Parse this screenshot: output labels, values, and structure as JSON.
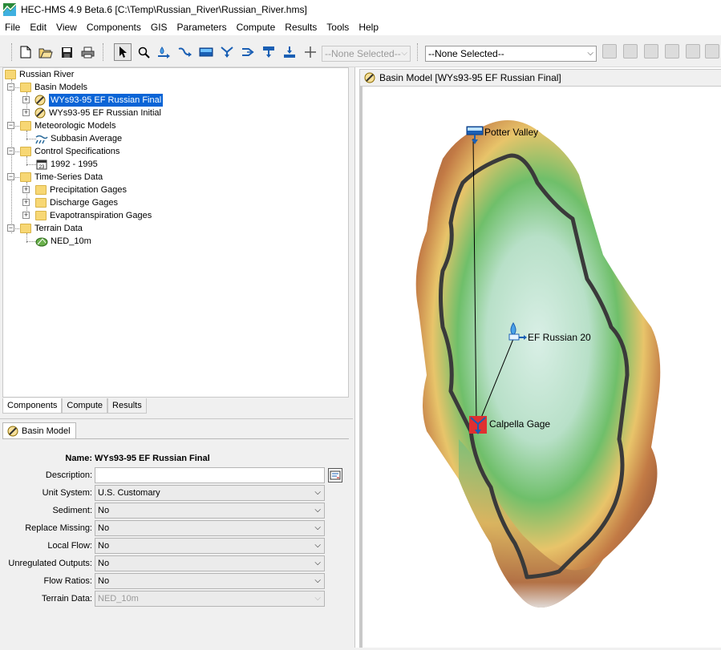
{
  "window": {
    "title": "HEC-HMS 4.9 Beta.6 [C:\\Temp\\Russian_River\\Russian_River.hms]"
  },
  "menu": [
    "File",
    "Edit",
    "View",
    "Components",
    "GIS",
    "Parameters",
    "Compute",
    "Results",
    "Tools",
    "Help"
  ],
  "toolbar": {
    "icons": [
      "new-file-icon",
      "open-folder-icon",
      "save-icon",
      "print-icon",
      "arrow-select-icon",
      "zoom-icon",
      "subbasin-tool-icon",
      "reach-tool-icon",
      "reservoir-tool-icon",
      "junction-tool-icon",
      "diversion-tool-icon",
      "source-tool-icon",
      "sink-tool-icon",
      "crosshair-icon"
    ],
    "element_combo": "--None Selected--",
    "run_combo": "--None Selected--",
    "right_icons": [
      "compute-icon",
      "graph-icon",
      "summary-icon",
      "timeseries-icon",
      "table-icon",
      "globe-icon"
    ]
  },
  "tree": {
    "root": "Russian River",
    "basin_models": "Basin Models",
    "basin_final": "WYs93-95 EF Russian Final",
    "basin_initial": "WYs93-95 EF Russian Initial",
    "met_models": "Meteorologic Models",
    "met_subbasin": "Subbasin Average",
    "control_specs": "Control Specifications",
    "control_item": "1992 - 1995",
    "control_icon_text": "23",
    "ts_data": "Time-Series Data",
    "precip_gages": "Precipitation Gages",
    "discharge_gages": "Discharge Gages",
    "et_gages": "Evapotranspiration Gages",
    "terrain_data": "Terrain Data",
    "terrain_item": "NED_10m"
  },
  "tabs": [
    "Components",
    "Compute",
    "Results"
  ],
  "props": {
    "tab": "Basin Model",
    "name_label": "Name:",
    "name_value": "WYs93-95 EF Russian Final",
    "rows": [
      {
        "label": "Description:",
        "value": ""
      },
      {
        "label": "Unit System:",
        "value": "U.S. Customary"
      },
      {
        "label": "Sediment:",
        "value": "No"
      },
      {
        "label": "Replace Missing:",
        "value": "No"
      },
      {
        "label": "Local Flow:",
        "value": "No"
      },
      {
        "label": "Unregulated Outputs:",
        "value": "No"
      },
      {
        "label": "Flow Ratios:",
        "value": "No"
      },
      {
        "label": "Terrain Data:",
        "value": "NED_10m"
      }
    ]
  },
  "map": {
    "title": "Basin Model [WYs93-95 EF Russian Final]",
    "potter_valley": "Potter Valley",
    "ef_russian": "EF Russian 20",
    "calpella": "Calpella Gage"
  }
}
